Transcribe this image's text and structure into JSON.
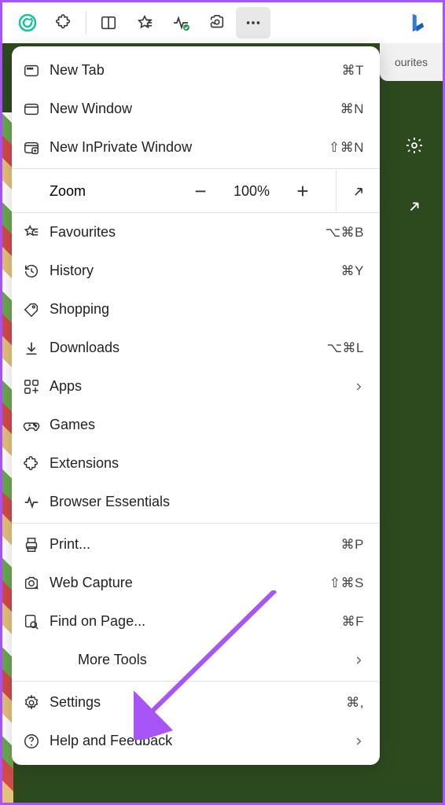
{
  "toolbar": {
    "favourites_label": "ourites"
  },
  "menu": {
    "new_tab": {
      "label": "New Tab",
      "shortcut": "⌘T"
    },
    "new_window": {
      "label": "New Window",
      "shortcut": "⌘N"
    },
    "new_inprivate": {
      "label": "New InPrivate Window",
      "shortcut": "⇧⌘N"
    },
    "zoom": {
      "label": "Zoom",
      "value": "100%"
    },
    "favourites": {
      "label": "Favourites",
      "shortcut": "⌥⌘B"
    },
    "history": {
      "label": "History",
      "shortcut": "⌘Y"
    },
    "shopping": {
      "label": "Shopping"
    },
    "downloads": {
      "label": "Downloads",
      "shortcut": "⌥⌘L"
    },
    "apps": {
      "label": "Apps"
    },
    "games": {
      "label": "Games"
    },
    "extensions": {
      "label": "Extensions"
    },
    "browser_essentials": {
      "label": "Browser Essentials"
    },
    "print": {
      "label": "Print...",
      "shortcut": "⌘P"
    },
    "web_capture": {
      "label": "Web Capture",
      "shortcut": "⇧⌘S"
    },
    "find": {
      "label": "Find on Page...",
      "shortcut": "⌘F"
    },
    "more_tools": {
      "label": "More Tools"
    },
    "settings": {
      "label": "Settings",
      "shortcut": "⌘,"
    },
    "help": {
      "label": "Help and Feedback"
    }
  }
}
